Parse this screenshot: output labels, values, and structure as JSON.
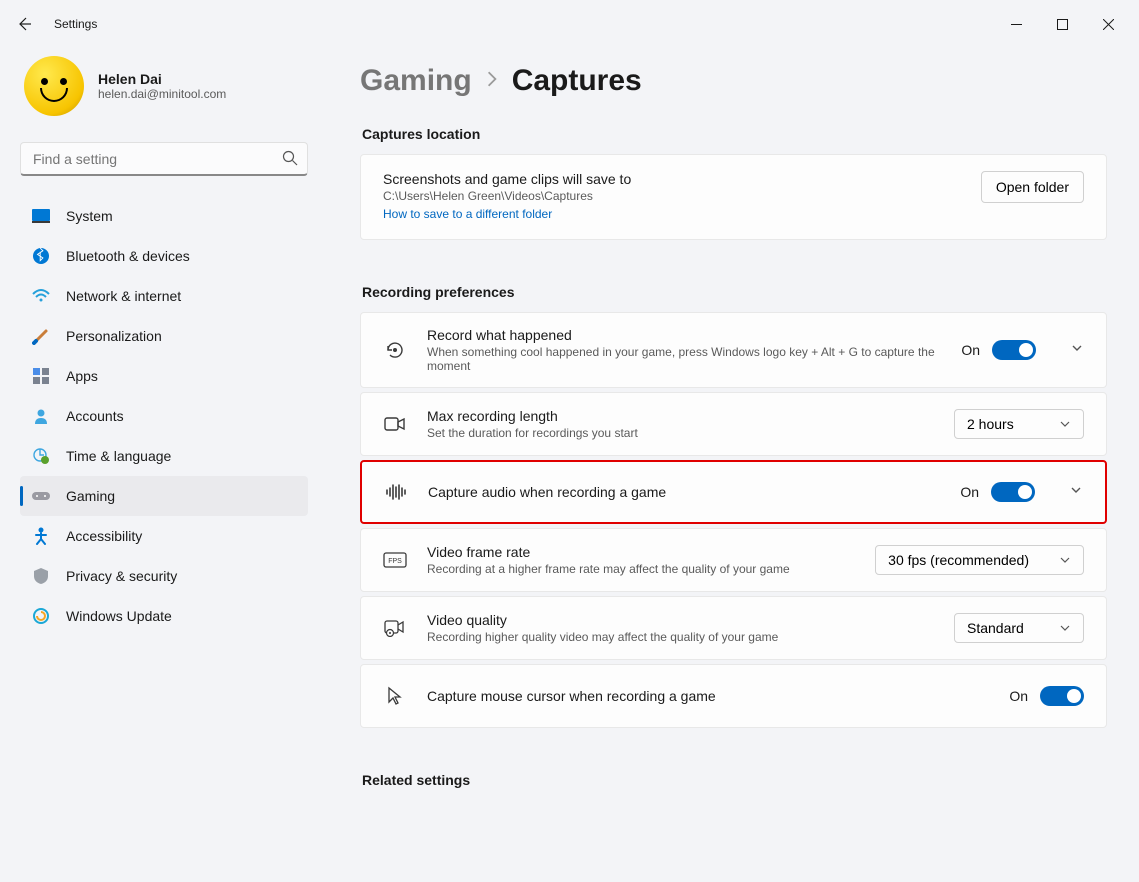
{
  "window": {
    "title": "Settings"
  },
  "profile": {
    "name": "Helen Dai",
    "email": "helen.dai@minitool.com"
  },
  "search": {
    "placeholder": "Find a setting"
  },
  "nav": [
    {
      "label": "System"
    },
    {
      "label": "Bluetooth & devices"
    },
    {
      "label": "Network & internet"
    },
    {
      "label": "Personalization"
    },
    {
      "label": "Apps"
    },
    {
      "label": "Accounts"
    },
    {
      "label": "Time & language"
    },
    {
      "label": "Gaming"
    },
    {
      "label": "Accessibility"
    },
    {
      "label": "Privacy & security"
    },
    {
      "label": "Windows Update"
    }
  ],
  "breadcrumb": {
    "parent": "Gaming",
    "current": "Captures"
  },
  "sections": {
    "location_label": "Captures location",
    "recording_label": "Recording preferences",
    "related_label": "Related settings"
  },
  "location_card": {
    "title": "Screenshots and game clips will save to",
    "path": "C:\\Users\\Helen Green\\Videos\\Captures",
    "link": "How to save to a different folder",
    "button": "Open folder"
  },
  "rows": {
    "record_happened": {
      "title": "Record what happened",
      "sub": "When something cool happened in your game, press Windows logo key + Alt + G to capture the moment",
      "state": "On"
    },
    "max_length": {
      "title": "Max recording length",
      "sub": "Set the duration for recordings you start",
      "value": "2 hours"
    },
    "capture_audio": {
      "title": "Capture audio when recording a game",
      "state": "On"
    },
    "frame_rate": {
      "title": "Video frame rate",
      "sub": "Recording at a higher frame rate may affect the quality of your game",
      "value": "30 fps (recommended)"
    },
    "video_quality": {
      "title": "Video quality",
      "sub": "Recording higher quality video may affect the quality of your game",
      "value": "Standard"
    },
    "mouse_cursor": {
      "title": "Capture mouse cursor when recording a game",
      "state": "On"
    }
  }
}
